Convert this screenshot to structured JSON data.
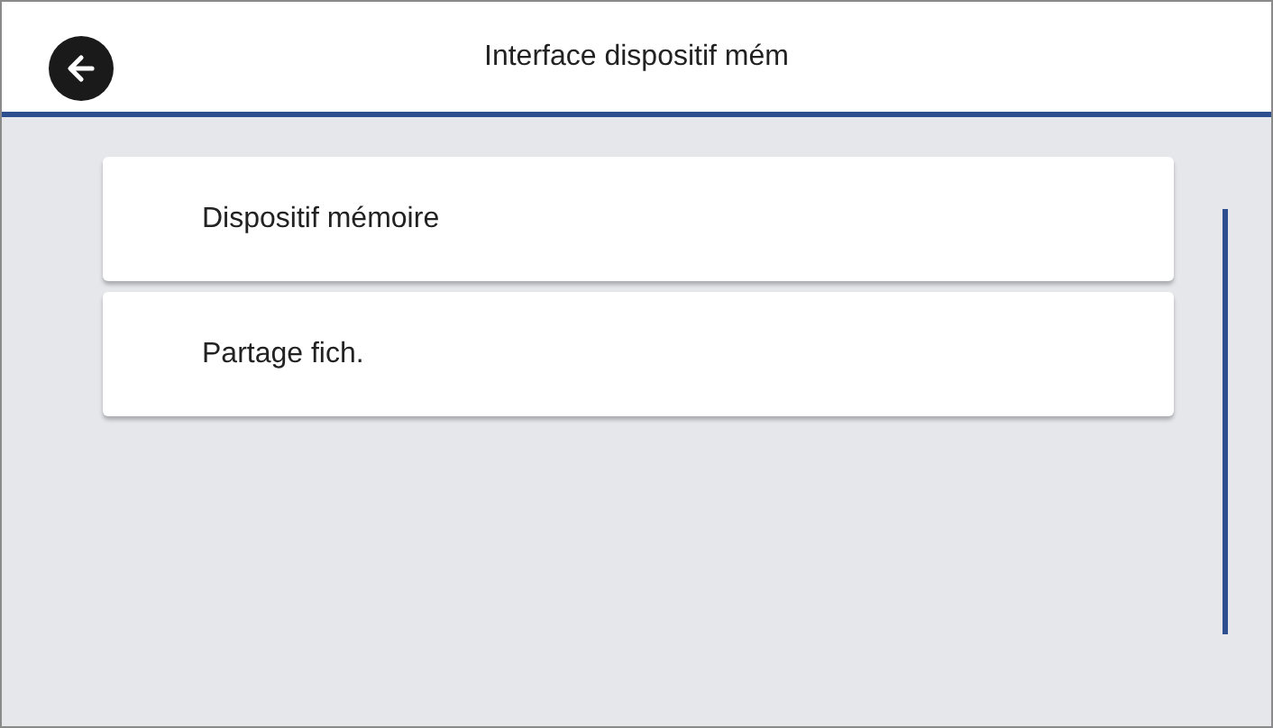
{
  "header": {
    "title": "Interface dispositif mém"
  },
  "menu": [
    {
      "label": "Dispositif mémoire"
    },
    {
      "label": "Partage fich."
    }
  ]
}
